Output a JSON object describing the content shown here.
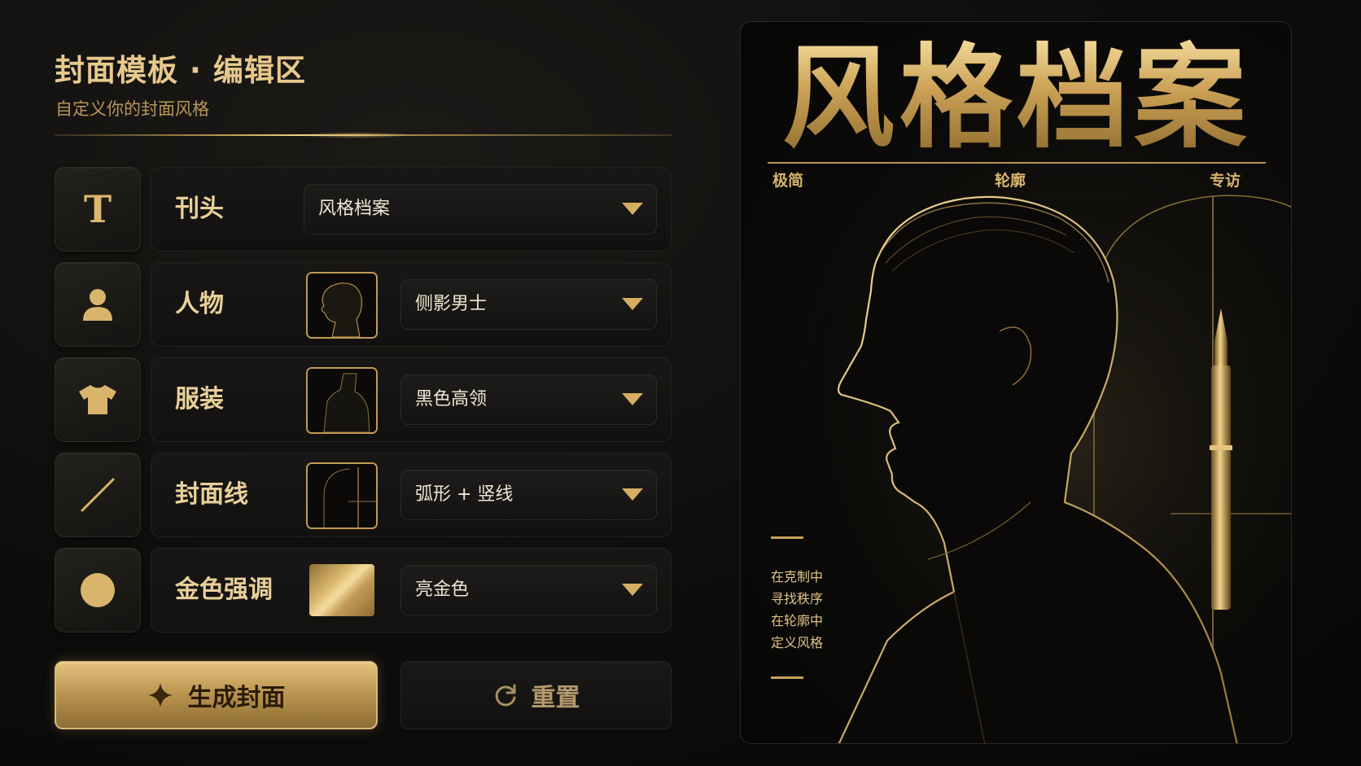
{
  "editor": {
    "title": "封面模板 · 编辑区",
    "subtitle": "自定义你的封面风格"
  },
  "rows": [
    {
      "icon": "text-T-icon",
      "label": "刊头",
      "value": "风格档案"
    },
    {
      "icon": "person-icon",
      "label": "人物",
      "value": "侧影男士"
    },
    {
      "icon": "tshirt-icon",
      "label": "服装",
      "value": "黑色高领"
    },
    {
      "icon": "line-icon",
      "label": "封面线",
      "value": "弧形 + 竖线"
    },
    {
      "icon": "circle-icon",
      "label": "金色强调",
      "value": "亮金色"
    }
  ],
  "buttons": {
    "generate": "生成封面",
    "reset": "重置"
  },
  "cover": {
    "masthead": "风格档案",
    "tags": [
      "极简",
      "轮廓",
      "专访"
    ],
    "tagline": [
      "在克制中",
      "寻找秩序",
      "在轮廓中",
      "定义风格"
    ]
  },
  "colors": {
    "gold": "#d6ae62",
    "gold_light": "#f3dc9e",
    "background": "#0e0d0c"
  }
}
